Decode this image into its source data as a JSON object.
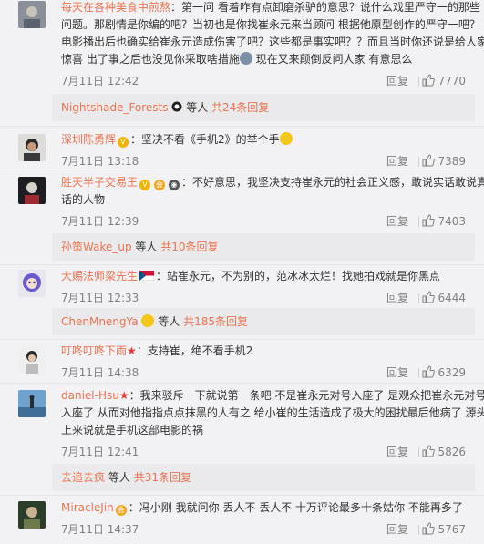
{
  "comments": [
    {
      "username": "每天在各种美食中煎熬",
      "lines": [
        "：第一问 看着咋有点卸磨杀驴的意思？说什么戏里严守一的那些",
        "问题。那剧情是你编的吧？当初也是你找崔永元来当顾问 根据他原型创作的严守一吧？",
        "电影播出后也确实给崔永元造成伤害了吧？这些都是事实吧？？而且当时你还说是给人家",
        "惊喜 出了事之后也没见你采取啥措施",
        " 现在又来颠倒反问人家 有意思么"
      ],
      "time": "7月11日 12:42",
      "reply_label": "回复",
      "likes": "7770"
    },
    {
      "username": "深圳陈勇辉",
      "lines": [
        "：坚决不看《手机2》的举个手"
      ],
      "time": "7月11日 13:18",
      "reply_label": "回复",
      "likes": "7389"
    },
    {
      "username": "胜天半子交易王",
      "lines": [
        "：不好意思，我坚决支持崔永元的社会正义感，敢说实话敢说真",
        "话的人物"
      ],
      "time": "7月11日 12:39",
      "reply_label": "回复",
      "likes": "7403"
    },
    {
      "username": "大赐法师梁先生",
      "lines": [
        "：站崔永元，不为别的，范冰冰太烂！找她拍戏就是你黑点"
      ],
      "time": "7月11日 12:33",
      "reply_label": "回复",
      "likes": "6444"
    },
    {
      "username": "叮咚叮咚下雨",
      "lines": [
        "：支持崔，绝不看手机2"
      ],
      "time": "7月11日 14:38",
      "reply_label": "回复",
      "likes": "6329"
    },
    {
      "username": "daniel-Hsu",
      "lines": [
        "：我来驳斥一下就说第一条吧 不是崔永元对号入座了 是观众把崔永元对号",
        "入座了 从而对他指指点点抹黑的人有之 给小崔的生活造成了极大的困扰最后他病了 源头",
        "上来说就是手机这部电影的祸"
      ],
      "time": "7月11日 12:41",
      "reply_label": "回复",
      "likes": "5826"
    },
    {
      "username": "MiracleJin",
      "lines": [
        "：冯小刚 我就问你 丢人不 丢人不 十万评论最多十条姑你 不能再多了"
      ],
      "time": "7月11日 14:37",
      "reply_label": "回复",
      "likes": "5767"
    }
  ],
  "sub_replies": [
    {
      "name": "Nightshade_Forests",
      "mid": "等人",
      "count": "共24条回复"
    },
    {
      "name": "孙策Wake_up",
      "mid": "等人",
      "count": "共10条回复"
    },
    {
      "name": "ChenMnengYa",
      "mid": "等人",
      "count": "共185条回复"
    },
    {
      "name": "去追去疯",
      "mid": "等人",
      "count": "共31条回复"
    }
  ],
  "colors": {
    "username": "#eb7350",
    "meta": "#808080",
    "background": "#f2f2f5"
  }
}
